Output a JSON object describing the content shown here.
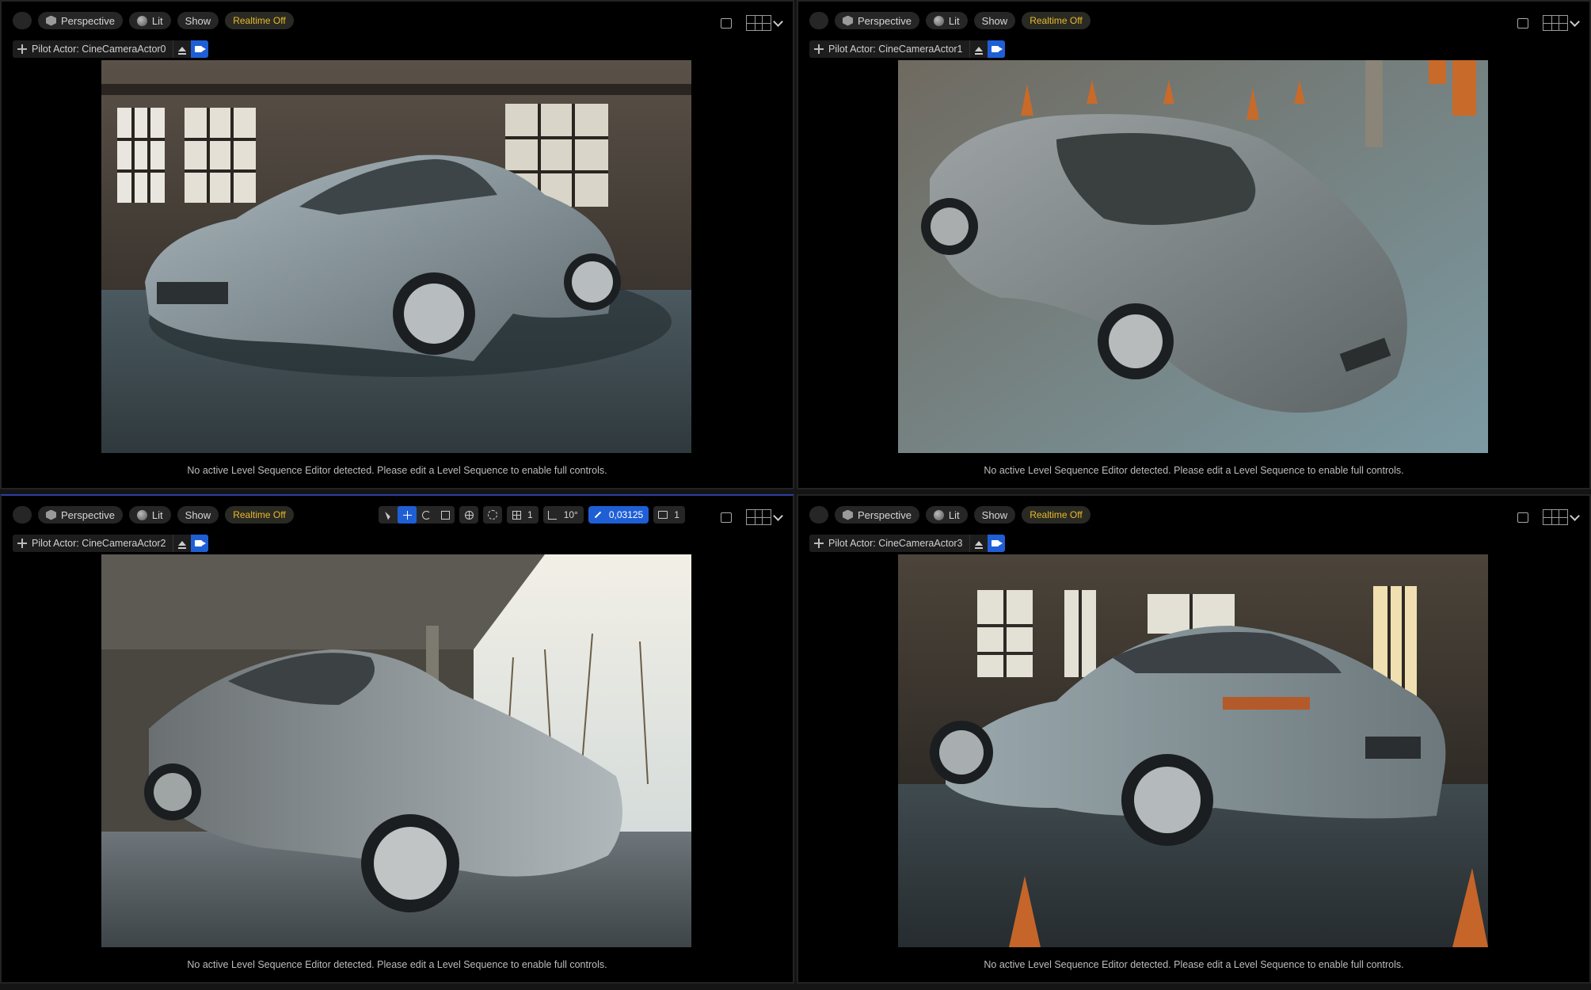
{
  "viewports": [
    {
      "toolbar": {
        "view_mode": "Perspective",
        "lighting": "Lit",
        "show": "Show",
        "realtime": "Realtime Off"
      },
      "pilot": "Pilot Actor: CineCameraActor0",
      "message": "No active Level Sequence Editor detected. Please edit a Level Sequence to enable full controls."
    },
    {
      "toolbar": {
        "view_mode": "Perspective",
        "lighting": "Lit",
        "show": "Show",
        "realtime": "Realtime Off"
      },
      "pilot": "Pilot Actor: CineCameraActor1",
      "message": "No active Level Sequence Editor detected. Please edit a Level Sequence to enable full controls."
    },
    {
      "toolbar": {
        "view_mode": "Perspective",
        "lighting": "Lit",
        "show": "Show",
        "realtime": "Realtime Off"
      },
      "pilot": "Pilot Actor: CineCameraActor2",
      "message": "No active Level Sequence Editor detected. Please edit a Level Sequence to enable full controls.",
      "transform_toolbar": {
        "grid_snap": "1",
        "rotation_snap": "10°",
        "scale_snap": "0,03125",
        "camera_speed": "1"
      }
    },
    {
      "toolbar": {
        "view_mode": "Perspective",
        "lighting": "Lit",
        "show": "Show",
        "realtime": "Realtime Off"
      },
      "pilot": "Pilot Actor: CineCameraActor3",
      "message": "No active Level Sequence Editor detected. Please edit a Level Sequence to enable full controls."
    }
  ],
  "colors": {
    "accent_blue": "#1f5fd6",
    "realtime_yellow": "#e8b92a",
    "car_paint": "#8e9aa0"
  }
}
